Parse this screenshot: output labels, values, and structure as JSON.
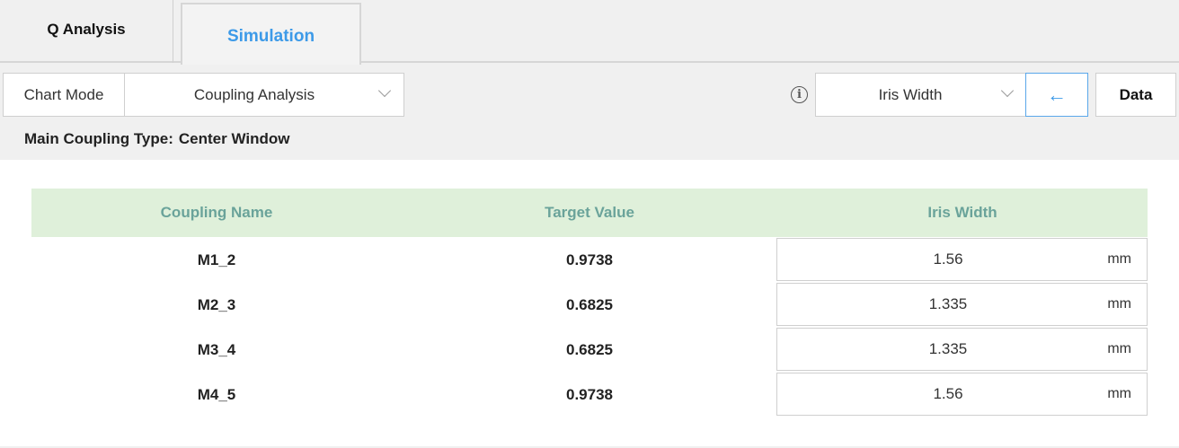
{
  "tabs": [
    {
      "label": "Q Analysis",
      "active": false
    },
    {
      "label": "Simulation",
      "active": true
    }
  ],
  "toolbar": {
    "chart_mode_label": "Chart Mode",
    "coupling_select_value": "Coupling Analysis",
    "param_select_value": "Iris Width",
    "back_icon_glyph": "←",
    "data_button_label": "Data",
    "info_icon_glyph": "i"
  },
  "main_coupling": {
    "label": "Main Coupling Type:",
    "value": "Center Window"
  },
  "table": {
    "headers": [
      "Coupling Name",
      "Target Value",
      "Iris Width"
    ],
    "rows": [
      {
        "name": "M1_2",
        "target": "0.9738",
        "iris": "1.56",
        "unit": "mm"
      },
      {
        "name": "M2_3",
        "target": "0.6825",
        "iris": "1.335",
        "unit": "mm"
      },
      {
        "name": "M3_4",
        "target": "0.6825",
        "iris": "1.335",
        "unit": "mm"
      },
      {
        "name": "M4_5",
        "target": "0.9738",
        "iris": "1.56",
        "unit": "mm"
      }
    ]
  },
  "colors": {
    "accent": "#3d9ae8",
    "header_bg": "#dff0da",
    "header_text": "#6aa39a"
  }
}
